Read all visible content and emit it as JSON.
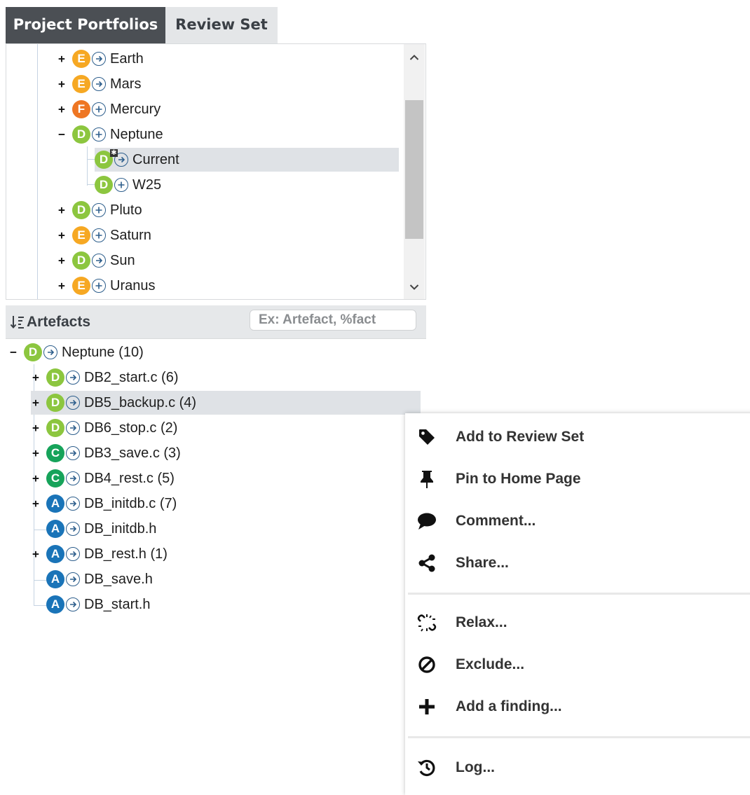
{
  "tabs": [
    {
      "label": "Project Portfolios",
      "active": true
    },
    {
      "label": "Review Set",
      "active": false
    }
  ],
  "colors": {
    "E": "#f6a823",
    "F": "#ee7623",
    "D": "#8cc63f",
    "C": "#16a35a",
    "A": "#1a74b8"
  },
  "portfolio": {
    "items": [
      {
        "label": "Earth",
        "grade": "E",
        "icon": "arrow",
        "expander": "+"
      },
      {
        "label": "Mars",
        "grade": "E",
        "icon": "arrow",
        "expander": "+"
      },
      {
        "label": "Mercury",
        "grade": "F",
        "icon": "plus",
        "expander": "+"
      },
      {
        "label": "Neptune",
        "grade": "D",
        "icon": "plus",
        "expander": "−"
      },
      {
        "label": "Current",
        "grade": "D",
        "icon": "arrow",
        "expander": ""
      },
      {
        "label": "W25",
        "grade": "D",
        "icon": "plus",
        "expander": ""
      },
      {
        "label": "Pluto",
        "grade": "D",
        "icon": "plus",
        "expander": "+"
      },
      {
        "label": "Saturn",
        "grade": "E",
        "icon": "plus",
        "expander": "+"
      },
      {
        "label": "Sun",
        "grade": "D",
        "icon": "arrow",
        "expander": "+"
      },
      {
        "label": "Uranus",
        "grade": "E",
        "icon": "plus",
        "expander": "+"
      }
    ]
  },
  "artefacts": {
    "title": "Artefacts",
    "search_placeholder": "Ex: Artefact, %fact",
    "items": [
      {
        "label": "Neptune (10)",
        "grade": "D",
        "expander": "−"
      },
      {
        "label": "DB2_start.c (6)",
        "grade": "D",
        "expander": "+"
      },
      {
        "label": "DB5_backup.c (4)",
        "grade": "D",
        "expander": "+"
      },
      {
        "label": "DB6_stop.c (2)",
        "grade": "D",
        "expander": "+"
      },
      {
        "label": "DB3_save.c (3)",
        "grade": "C",
        "expander": "+"
      },
      {
        "label": "DB4_rest.c (5)",
        "grade": "C",
        "expander": "+"
      },
      {
        "label": "DB_initdb.c (7)",
        "grade": "A",
        "expander": "+"
      },
      {
        "label": "DB_initdb.h",
        "grade": "A",
        "expander": ""
      },
      {
        "label": "DB_rest.h (1)",
        "grade": "A",
        "expander": "+"
      },
      {
        "label": "DB_save.h",
        "grade": "A",
        "expander": ""
      },
      {
        "label": "DB_start.h",
        "grade": "A",
        "expander": ""
      }
    ]
  },
  "context_menu": {
    "items": [
      {
        "label": "Add to Review Set",
        "icon": "tag-icon"
      },
      {
        "label": "Pin to Home Page",
        "icon": "pin-icon"
      },
      {
        "label": "Comment...",
        "icon": "comment-icon"
      },
      {
        "label": "Share...",
        "icon": "share-icon"
      },
      {
        "label": "Relax...",
        "icon": "unlink-icon"
      },
      {
        "label": "Exclude...",
        "icon": "ban-icon"
      },
      {
        "label": "Add a finding...",
        "icon": "plus-icon"
      },
      {
        "label": "Log...",
        "icon": "history-icon"
      }
    ]
  }
}
